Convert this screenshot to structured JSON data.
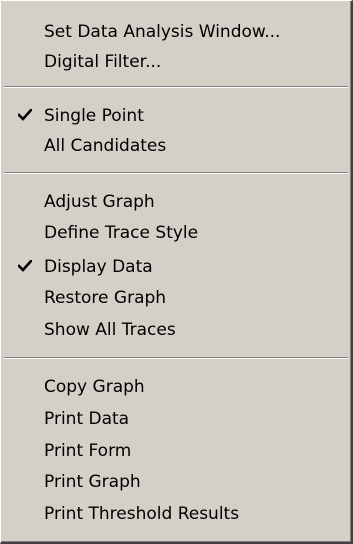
{
  "menu": {
    "groups": [
      {
        "items": [
          {
            "label": "Set Data Analysis Window...",
            "checked": false
          },
          {
            "label": "Digital Filter...",
            "checked": false
          }
        ]
      },
      {
        "items": [
          {
            "label": "Single Point",
            "checked": true
          },
          {
            "label": "All Candidates",
            "checked": false
          }
        ]
      },
      {
        "items": [
          {
            "label": "Adjust Graph",
            "checked": false
          },
          {
            "label": "Define Trace Style",
            "checked": false
          },
          {
            "label": "Display Data",
            "checked": true
          },
          {
            "label": "Restore Graph",
            "checked": false
          },
          {
            "label": "Show All Traces",
            "checked": false
          }
        ]
      },
      {
        "items": [
          {
            "label": "Copy Graph",
            "checked": false
          },
          {
            "label": "Print Data",
            "checked": false
          },
          {
            "label": "Print Form",
            "checked": false
          },
          {
            "label": "Print Graph",
            "checked": false
          },
          {
            "label": "Print Threshold Results",
            "checked": false
          }
        ]
      }
    ]
  }
}
